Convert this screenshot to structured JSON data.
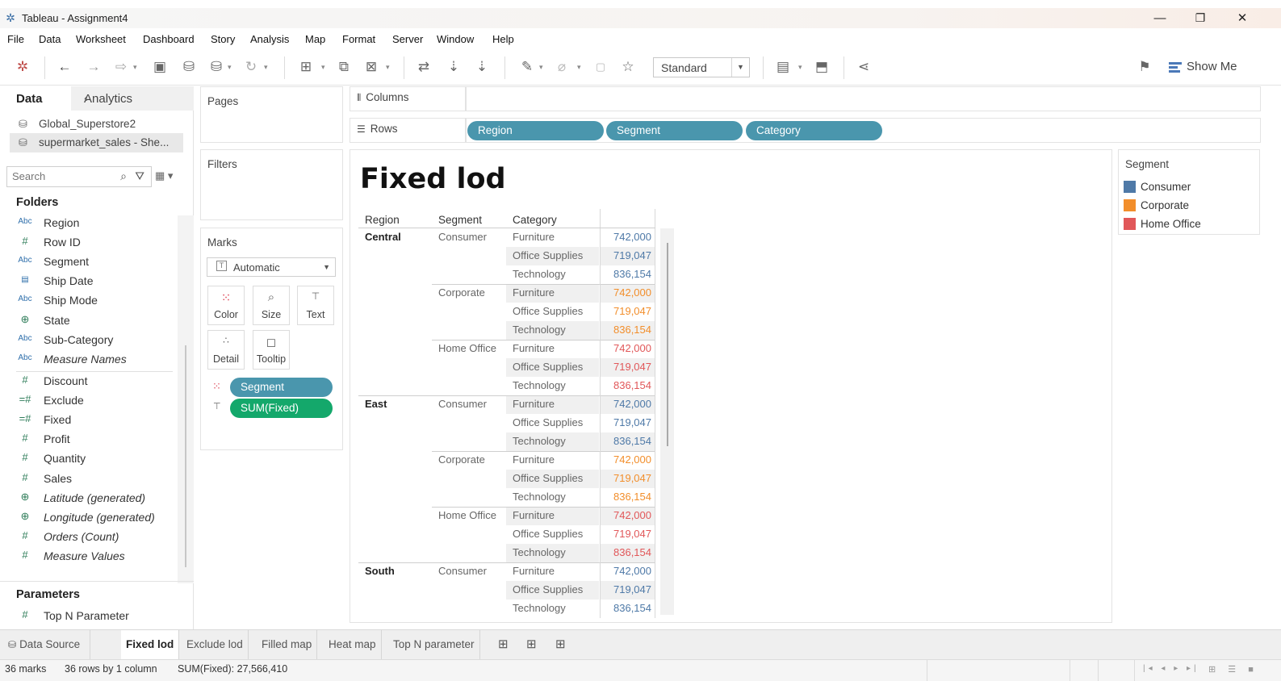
{
  "window": {
    "title": "Tableau - Assignment4",
    "controls": {
      "minimize": "—",
      "restore": "❐",
      "close": "✕"
    }
  },
  "menu": [
    "File",
    "Data",
    "Worksheet",
    "Dashboard",
    "Story",
    "Analysis",
    "Map",
    "Format",
    "Server",
    "Window",
    "Help"
  ],
  "toolbar": {
    "fit_value": "Standard",
    "show_me_label": "Show Me"
  },
  "data_pane": {
    "tabs": {
      "data": "Data",
      "analytics": "Analytics"
    },
    "data_sources": [
      "Global_Superstore2",
      "supermarket_sales - She..."
    ],
    "search_placeholder": "Search",
    "folders_label": "Folders",
    "dimensions": [
      {
        "type": "Abc",
        "name": "Region",
        "italic": false
      },
      {
        "type": "#",
        "name": "Row ID",
        "italic": false
      },
      {
        "type": "Abc",
        "name": "Segment",
        "italic": false
      },
      {
        "type": "date",
        "name": "Ship Date",
        "italic": false
      },
      {
        "type": "Abc",
        "name": "Ship Mode",
        "italic": false
      },
      {
        "type": "geo",
        "name": "State",
        "italic": false
      },
      {
        "type": "Abc",
        "name": "Sub-Category",
        "italic": false
      },
      {
        "type": "Abc",
        "name": "Measure Names",
        "italic": true
      }
    ],
    "measures": [
      {
        "type": "#",
        "name": "Discount",
        "italic": false
      },
      {
        "type": "=#",
        "name": "Exclude",
        "italic": false
      },
      {
        "type": "=#",
        "name": "Fixed",
        "italic": false
      },
      {
        "type": "#",
        "name": "Profit",
        "italic": false
      },
      {
        "type": "#",
        "name": "Quantity",
        "italic": false
      },
      {
        "type": "#",
        "name": "Sales",
        "italic": false
      },
      {
        "type": "geo",
        "name": "Latitude (generated)",
        "italic": true
      },
      {
        "type": "geo",
        "name": "Longitude (generated)",
        "italic": true
      },
      {
        "type": "#",
        "name": "Orders (Count)",
        "italic": true
      },
      {
        "type": "#",
        "name": "Measure Values",
        "italic": true
      }
    ],
    "parameters_label": "Parameters",
    "parameters": [
      {
        "type": "#",
        "name": "Top N Parameter"
      }
    ]
  },
  "cards": {
    "pages": "Pages",
    "filters": "Filters",
    "marks": "Marks",
    "mark_type": "Automatic",
    "mark_buttons": {
      "color": "Color",
      "size": "Size",
      "text": "Text",
      "detail": "Detail",
      "tooltip": "Tooltip"
    },
    "mark_pills": {
      "color_pill": "Segment",
      "text_pill": "SUM(Fixed)"
    }
  },
  "shelves": {
    "columns_label": "Columns",
    "rows_label": "Rows",
    "rows_pills": [
      "Region",
      "Segment",
      "Category"
    ]
  },
  "view": {
    "title": "Fixed lod",
    "headers": {
      "region": "Region",
      "segment": "Segment",
      "category": "Category"
    },
    "rows": [
      {
        "region": "Central",
        "segment": "Consumer",
        "category": "Furniture",
        "value": "742,000",
        "seg": "Consumer"
      },
      {
        "region": "",
        "segment": "",
        "category": "Office Supplies",
        "value": "719,047",
        "seg": "Consumer"
      },
      {
        "region": "",
        "segment": "",
        "category": "Technology",
        "value": "836,154",
        "seg": "Consumer"
      },
      {
        "region": "",
        "segment": "Corporate",
        "category": "Furniture",
        "value": "742,000",
        "seg": "Corporate"
      },
      {
        "region": "",
        "segment": "",
        "category": "Office Supplies",
        "value": "719,047",
        "seg": "Corporate"
      },
      {
        "region": "",
        "segment": "",
        "category": "Technology",
        "value": "836,154",
        "seg": "Corporate"
      },
      {
        "region": "",
        "segment": "Home Office",
        "category": "Furniture",
        "value": "742,000",
        "seg": "Home Office"
      },
      {
        "region": "",
        "segment": "",
        "category": "Office Supplies",
        "value": "719,047",
        "seg": "Home Office"
      },
      {
        "region": "",
        "segment": "",
        "category": "Technology",
        "value": "836,154",
        "seg": "Home Office"
      },
      {
        "region": "East",
        "segment": "Consumer",
        "category": "Furniture",
        "value": "742,000",
        "seg": "Consumer"
      },
      {
        "region": "",
        "segment": "",
        "category": "Office Supplies",
        "value": "719,047",
        "seg": "Consumer"
      },
      {
        "region": "",
        "segment": "",
        "category": "Technology",
        "value": "836,154",
        "seg": "Consumer"
      },
      {
        "region": "",
        "segment": "Corporate",
        "category": "Furniture",
        "value": "742,000",
        "seg": "Corporate"
      },
      {
        "region": "",
        "segment": "",
        "category": "Office Supplies",
        "value": "719,047",
        "seg": "Corporate"
      },
      {
        "region": "",
        "segment": "",
        "category": "Technology",
        "value": "836,154",
        "seg": "Corporate"
      },
      {
        "region": "",
        "segment": "Home Office",
        "category": "Furniture",
        "value": "742,000",
        "seg": "Home Office"
      },
      {
        "region": "",
        "segment": "",
        "category": "Office Supplies",
        "value": "719,047",
        "seg": "Home Office"
      },
      {
        "region": "",
        "segment": "",
        "category": "Technology",
        "value": "836,154",
        "seg": "Home Office"
      },
      {
        "region": "South",
        "segment": "Consumer",
        "category": "Furniture",
        "value": "742,000",
        "seg": "Consumer"
      },
      {
        "region": "",
        "segment": "",
        "category": "Office Supplies",
        "value": "719,047",
        "seg": "Consumer"
      },
      {
        "region": "",
        "segment": "",
        "category": "Technology",
        "value": "836,154",
        "seg": "Consumer"
      }
    ]
  },
  "legend": {
    "title": "Segment",
    "items": [
      {
        "label": "Consumer",
        "color": "#4e79a7"
      },
      {
        "label": "Corporate",
        "color": "#f28e2b"
      },
      {
        "label": "Home Office",
        "color": "#e15759"
      }
    ]
  },
  "segment_colors": {
    "Consumer": "#4e79a7",
    "Corporate": "#f28e2b",
    "Home Office": "#e15759"
  },
  "sheet_tabs": {
    "data_source": "Data Source",
    "sheets": [
      "Fixed lod",
      "Exclude lod",
      "Filled map",
      "Heat map",
      "Top N parameter"
    ],
    "active": "Fixed lod"
  },
  "status": {
    "marks": "36 marks",
    "dims": "36 rows by 1 column",
    "sum": "SUM(Fixed): 27,566,410"
  }
}
